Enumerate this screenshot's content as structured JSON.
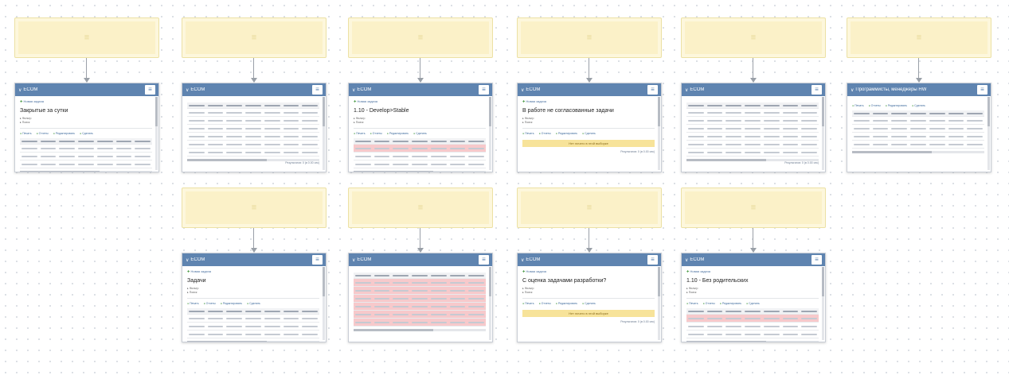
{
  "board": {
    "slot_icon": "≡",
    "menu_icon": "≡",
    "chevron_icon": "∨",
    "new_task_label": "Новая задача",
    "toolbar": {
      "print": "Печать",
      "reset": "Отчеты",
      "edit": "Редактировать",
      "save": "Сделать"
    },
    "filters": {
      "f1": "Фильтр",
      "f2": "Поиск"
    },
    "warning_text": "Нет ничего в этой выборке",
    "footer_note": "Результатов: 0 (в 0.00 сек)",
    "widgets": [
      {
        "title": "ECOM",
        "heading": "Закрытые за сутки",
        "kind": "list"
      },
      {
        "title": "ECOM",
        "heading": "",
        "kind": "table"
      },
      {
        "title": "ECOM",
        "heading": "1.10 - Develop>Stable",
        "kind": "list-pink"
      },
      {
        "title": "ECOM",
        "heading": "В работе не согласованные задачи",
        "kind": "warn"
      },
      {
        "title": "ECOM",
        "heading": "",
        "kind": "table"
      },
      {
        "title": "Программисты, менеджеры HW",
        "heading": "",
        "kind": "table-nohead"
      },
      {
        "title": "ECOM",
        "heading": "Задачи",
        "kind": "list"
      },
      {
        "title": "ECOM",
        "heading": "",
        "kind": "table-pink"
      },
      {
        "title": "ECOM",
        "heading": "С оценка задачами разработки?",
        "kind": "warn"
      },
      {
        "title": "ECOM",
        "heading": "1.10 - Без родительских",
        "kind": "list-pink"
      }
    ]
  }
}
